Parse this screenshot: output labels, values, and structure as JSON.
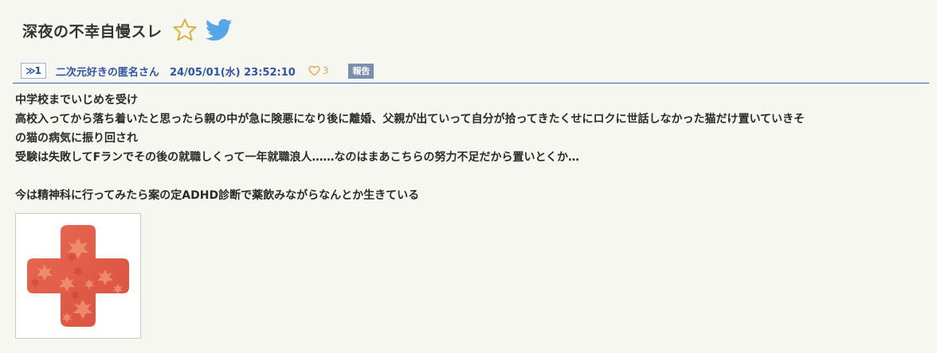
{
  "thread": {
    "title": "深夜の不幸自慢スレ"
  },
  "icons": {
    "favorite": "star-outline-icon",
    "share": "twitter-bird-icon",
    "like": "heart-outline-icon"
  },
  "colors": {
    "accent": "#2c55a5",
    "star": "#d8b23a",
    "twitter": "#55a6e8",
    "like": "#e8a24a",
    "report_bg": "#7a8fb0",
    "divider": "#3a62b0",
    "cross": "#e25a45"
  },
  "post": {
    "number": "1",
    "number_prefix": "≫",
    "author": "二次元好きの匿名さん",
    "datetime": "24/05/01(水) 23:52:10",
    "like_count": "3",
    "report_label": "報告",
    "lines": [
      "中学校までいじめを受け",
      "高校入ってから落ち着いたと思ったら親の中が急に険悪になり後に離婚、父親が出ていって自分が拾ってきたくせにロクに世話しなかった猫だけ置いていきそ",
      "の猫の病気に振り回され",
      "受験は失敗してFランでその後の就職しくって一年就職浪人……なのはまあこちらの努力不足だから置いとくか…",
      "",
      "今は精神科に行ってみたら案の定ADHD診断で薬飲みながらなんとか生きている"
    ],
    "image": {
      "subject": "red-cross-icon"
    }
  }
}
